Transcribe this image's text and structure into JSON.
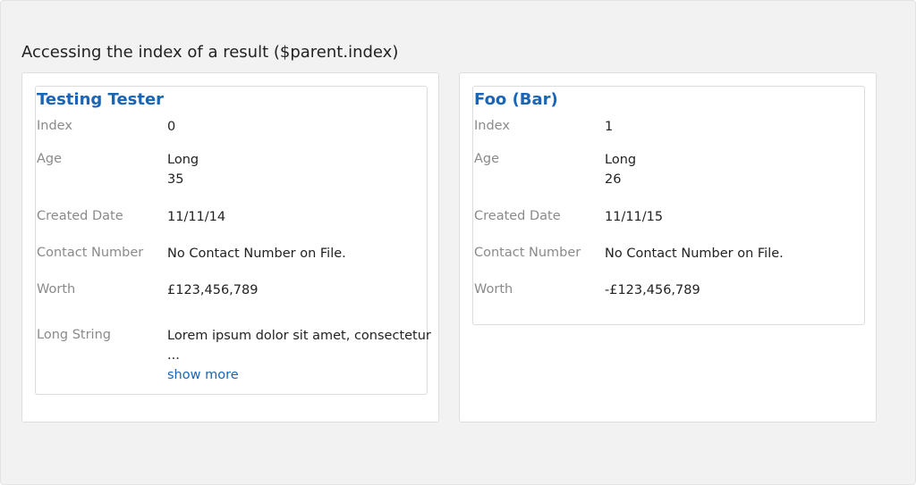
{
  "page": {
    "title": "Accessing the index of a result ($parent.index)"
  },
  "labels": {
    "index": "Index",
    "age": "Age",
    "created_date": "Created Date",
    "contact_number": "Contact Number",
    "worth": "Worth",
    "long_string": "Long String",
    "show_more": "show more"
  },
  "cards": [
    {
      "name": "Testing Tester",
      "index": "0",
      "age_type": "Long",
      "age": "35",
      "created_date": "11/11/14",
      "contact_number": "No Contact Number on File.",
      "worth": "£123,456,789",
      "long_string": "Lorem ipsum dolor sit amet, consectetur",
      "ellipsis": "..."
    },
    {
      "name": "Foo (Bar)",
      "index": "1",
      "age_type": "Long",
      "age": "26",
      "created_date": "11/11/15",
      "contact_number": "No Contact Number on File.",
      "worth": "-£123,456,789"
    }
  ],
  "colors": {
    "link": "#1a65b7",
    "label": "#8a8a8a",
    "text": "#222222",
    "background": "#f2f2f2"
  }
}
